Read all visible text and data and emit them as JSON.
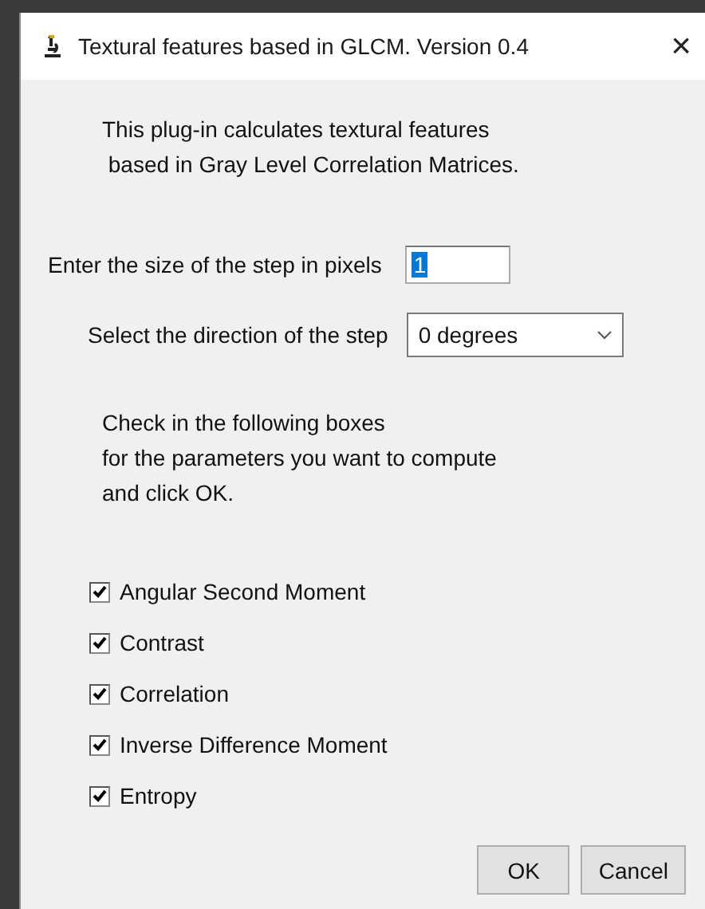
{
  "window": {
    "title": "Textural features based in GLCM. Version 0.4",
    "close": "×"
  },
  "intro": [
    "This plug-in calculates textural features",
    " based in Gray Level Correlation Matrices."
  ],
  "step": {
    "label": "Enter the size of the step in pixels",
    "value": "1"
  },
  "direction": {
    "label": "Select the direction of the step",
    "value": "0 degrees"
  },
  "instructions": [
    "Check in the following boxes",
    "for the parameters you want to compute",
    "and click OK."
  ],
  "options": [
    {
      "label": "Angular Second Moment",
      "checked": true
    },
    {
      "label": "Contrast",
      "checked": true
    },
    {
      "label": "Correlation",
      "checked": true
    },
    {
      "label": "Inverse Difference Moment",
      "checked": true
    },
    {
      "label": "Entropy",
      "checked": true
    }
  ],
  "buttons": [
    "OK",
    "Cancel"
  ]
}
